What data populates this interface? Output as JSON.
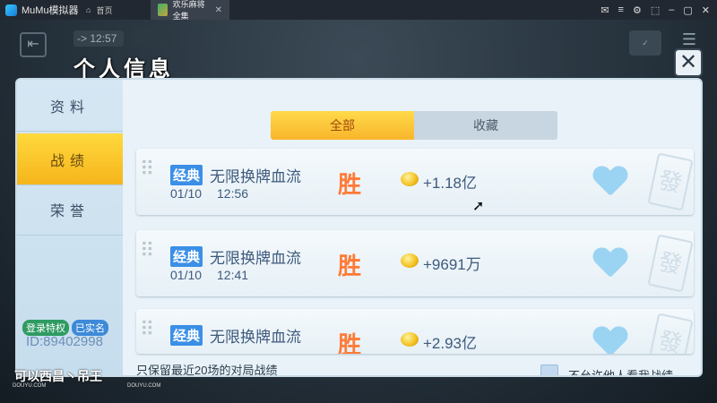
{
  "window": {
    "app_name": "MuMu模拟器",
    "tabs": [
      {
        "label": "首页",
        "active": false
      },
      {
        "label": "欢乐麻将全集",
        "active": true
      }
    ],
    "controls": [
      "✉",
      "≡",
      "⚙",
      "⬚",
      "–",
      "▢",
      "✕"
    ]
  },
  "hud": {
    "clock": "-> 12:57",
    "exit_icon": "exit-door-icon",
    "right_icon": "settings-icon"
  },
  "page": {
    "title": "个人信息",
    "close_icon": "close-cross-icon"
  },
  "sidebar": {
    "items": [
      {
        "label": "资料",
        "active": false
      },
      {
        "label": "战绩",
        "active": true
      },
      {
        "label": "荣誉",
        "active": false
      }
    ],
    "vip_label": "登录特权",
    "realname_label": "已实名",
    "player_id": "ID:89402998"
  },
  "filter": {
    "all_label": "全部",
    "fav_label": "收藏",
    "selected": "全部"
  },
  "records": [
    {
      "tag": "经典",
      "mode": "无限换牌血流",
      "date": "01/10",
      "time": "12:56",
      "result": "胜",
      "amount": "+1.18亿"
    },
    {
      "tag": "经典",
      "mode": "无限换牌血流",
      "date": "01/10",
      "time": "12:41",
      "result": "胜",
      "amount": "+9691万"
    },
    {
      "tag": "经典",
      "mode": "无限换牌血流",
      "date": "",
      "time": "",
      "result": "胜",
      "amount": "+2.93亿"
    }
  ],
  "footer": {
    "note": "只保留最近20场的对局战绩",
    "privacy_label": "不允许他人看我战绩"
  },
  "overlay": {
    "watermark": "DOUYU.COM",
    "streamer": "可以西昌丶吊王"
  },
  "colors": {
    "active_gold": "#f8b52a",
    "tag_blue": "#3b8fe6",
    "win_orange": "#ff7b36",
    "heart_blue": "#9bd4f3"
  }
}
